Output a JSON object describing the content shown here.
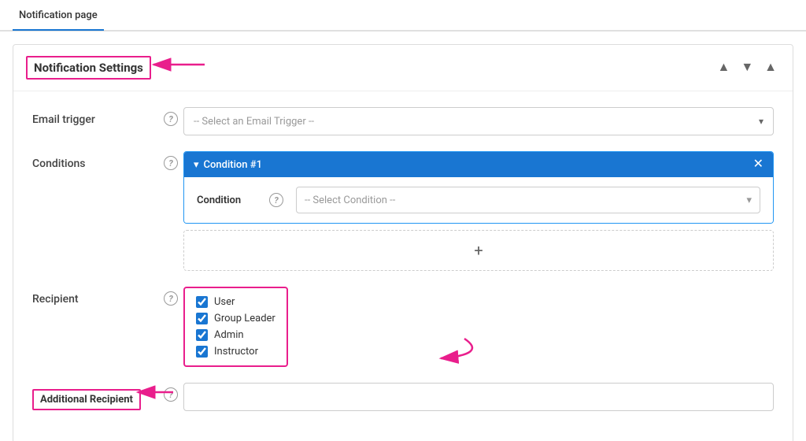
{
  "tab": {
    "label": "Notification page"
  },
  "section": {
    "title": "Notification Settings",
    "controls": {
      "up": "▲",
      "down": "▼",
      "expand": "▲"
    }
  },
  "form": {
    "email_trigger": {
      "label": "Email trigger",
      "placeholder": "-- Select an Email Trigger --"
    },
    "conditions": {
      "label": "Conditions",
      "condition1": {
        "title": "Condition #1",
        "inner_label": "Condition",
        "select_placeholder": "-- Select Condition --"
      },
      "add_button": "+"
    },
    "recipient": {
      "label": "Recipient",
      "options": [
        {
          "label": "User",
          "checked": true
        },
        {
          "label": "Group Leader",
          "checked": true
        },
        {
          "label": "Admin",
          "checked": true
        },
        {
          "label": "Instructor",
          "checked": true
        }
      ]
    },
    "additional_recipient": {
      "label": "Additional Recipient",
      "placeholder": ""
    }
  },
  "icons": {
    "chevron_down": "▾",
    "chevron_up": "▴",
    "close": "✕",
    "question": "?",
    "plus": "+"
  }
}
